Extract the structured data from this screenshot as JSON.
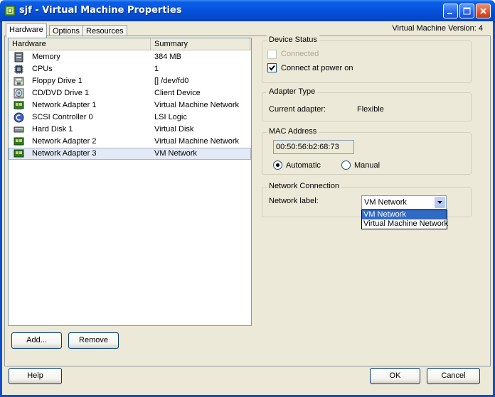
{
  "window": {
    "title": "sjf - Virtual Machine Properties",
    "accent_color": "#0653dd"
  },
  "tabs": [
    {
      "label": "Hardware",
      "active": true
    },
    {
      "label": "Options",
      "active": false
    },
    {
      "label": "Resources",
      "active": false
    }
  ],
  "vm_version": "Virtual Machine Version: 4",
  "hardware": {
    "columns": [
      "Hardware",
      "Summary"
    ],
    "rows": [
      {
        "name": "Memory",
        "summary": "384 MB",
        "icon": "memory-icon"
      },
      {
        "name": "CPUs",
        "summary": "1",
        "icon": "cpu-icon"
      },
      {
        "name": "Floppy Drive 1",
        "summary": "[] /dev/fd0",
        "icon": "floppy-icon"
      },
      {
        "name": "CD/DVD Drive 1",
        "summary": "Client Device",
        "icon": "cdrom-icon"
      },
      {
        "name": "Network Adapter 1",
        "summary": "Virtual Machine Network",
        "icon": "network-adapter-icon"
      },
      {
        "name": "SCSI Controller 0",
        "summary": "LSI Logic",
        "icon": "scsi-controller-icon"
      },
      {
        "name": "Hard Disk 1",
        "summary": "Virtual Disk",
        "icon": "hard-disk-icon"
      },
      {
        "name": "Network Adapter 2",
        "summary": "Virtual Machine Network",
        "icon": "network-adapter-icon"
      },
      {
        "name": "Network Adapter 3",
        "summary": "VM Network",
        "icon": "network-adapter-icon",
        "selected": true
      }
    ],
    "add_label": "Add...",
    "remove_label": "Remove"
  },
  "device_status": {
    "title": "Device Status",
    "connected_label": "Connected",
    "connected_checked": false,
    "connected_enabled": false,
    "connect_power_label": "Connect at power on",
    "connect_power_checked": true
  },
  "adapter_type": {
    "title": "Adapter Type",
    "current_label": "Current adapter:",
    "current_value": "Flexible"
  },
  "mac_address": {
    "title": "MAC Address",
    "value": "00:50:56:b2:68:73",
    "automatic_label": "Automatic",
    "manual_label": "Manual",
    "selected": "Automatic"
  },
  "network_connection": {
    "title": "Network Connection",
    "label": "Network label:",
    "selected": "VM Network",
    "options": [
      "VM Network",
      "Virtual Machine Network"
    ]
  },
  "footer": {
    "help_label": "Help",
    "ok_label": "OK",
    "cancel_label": "Cancel"
  }
}
